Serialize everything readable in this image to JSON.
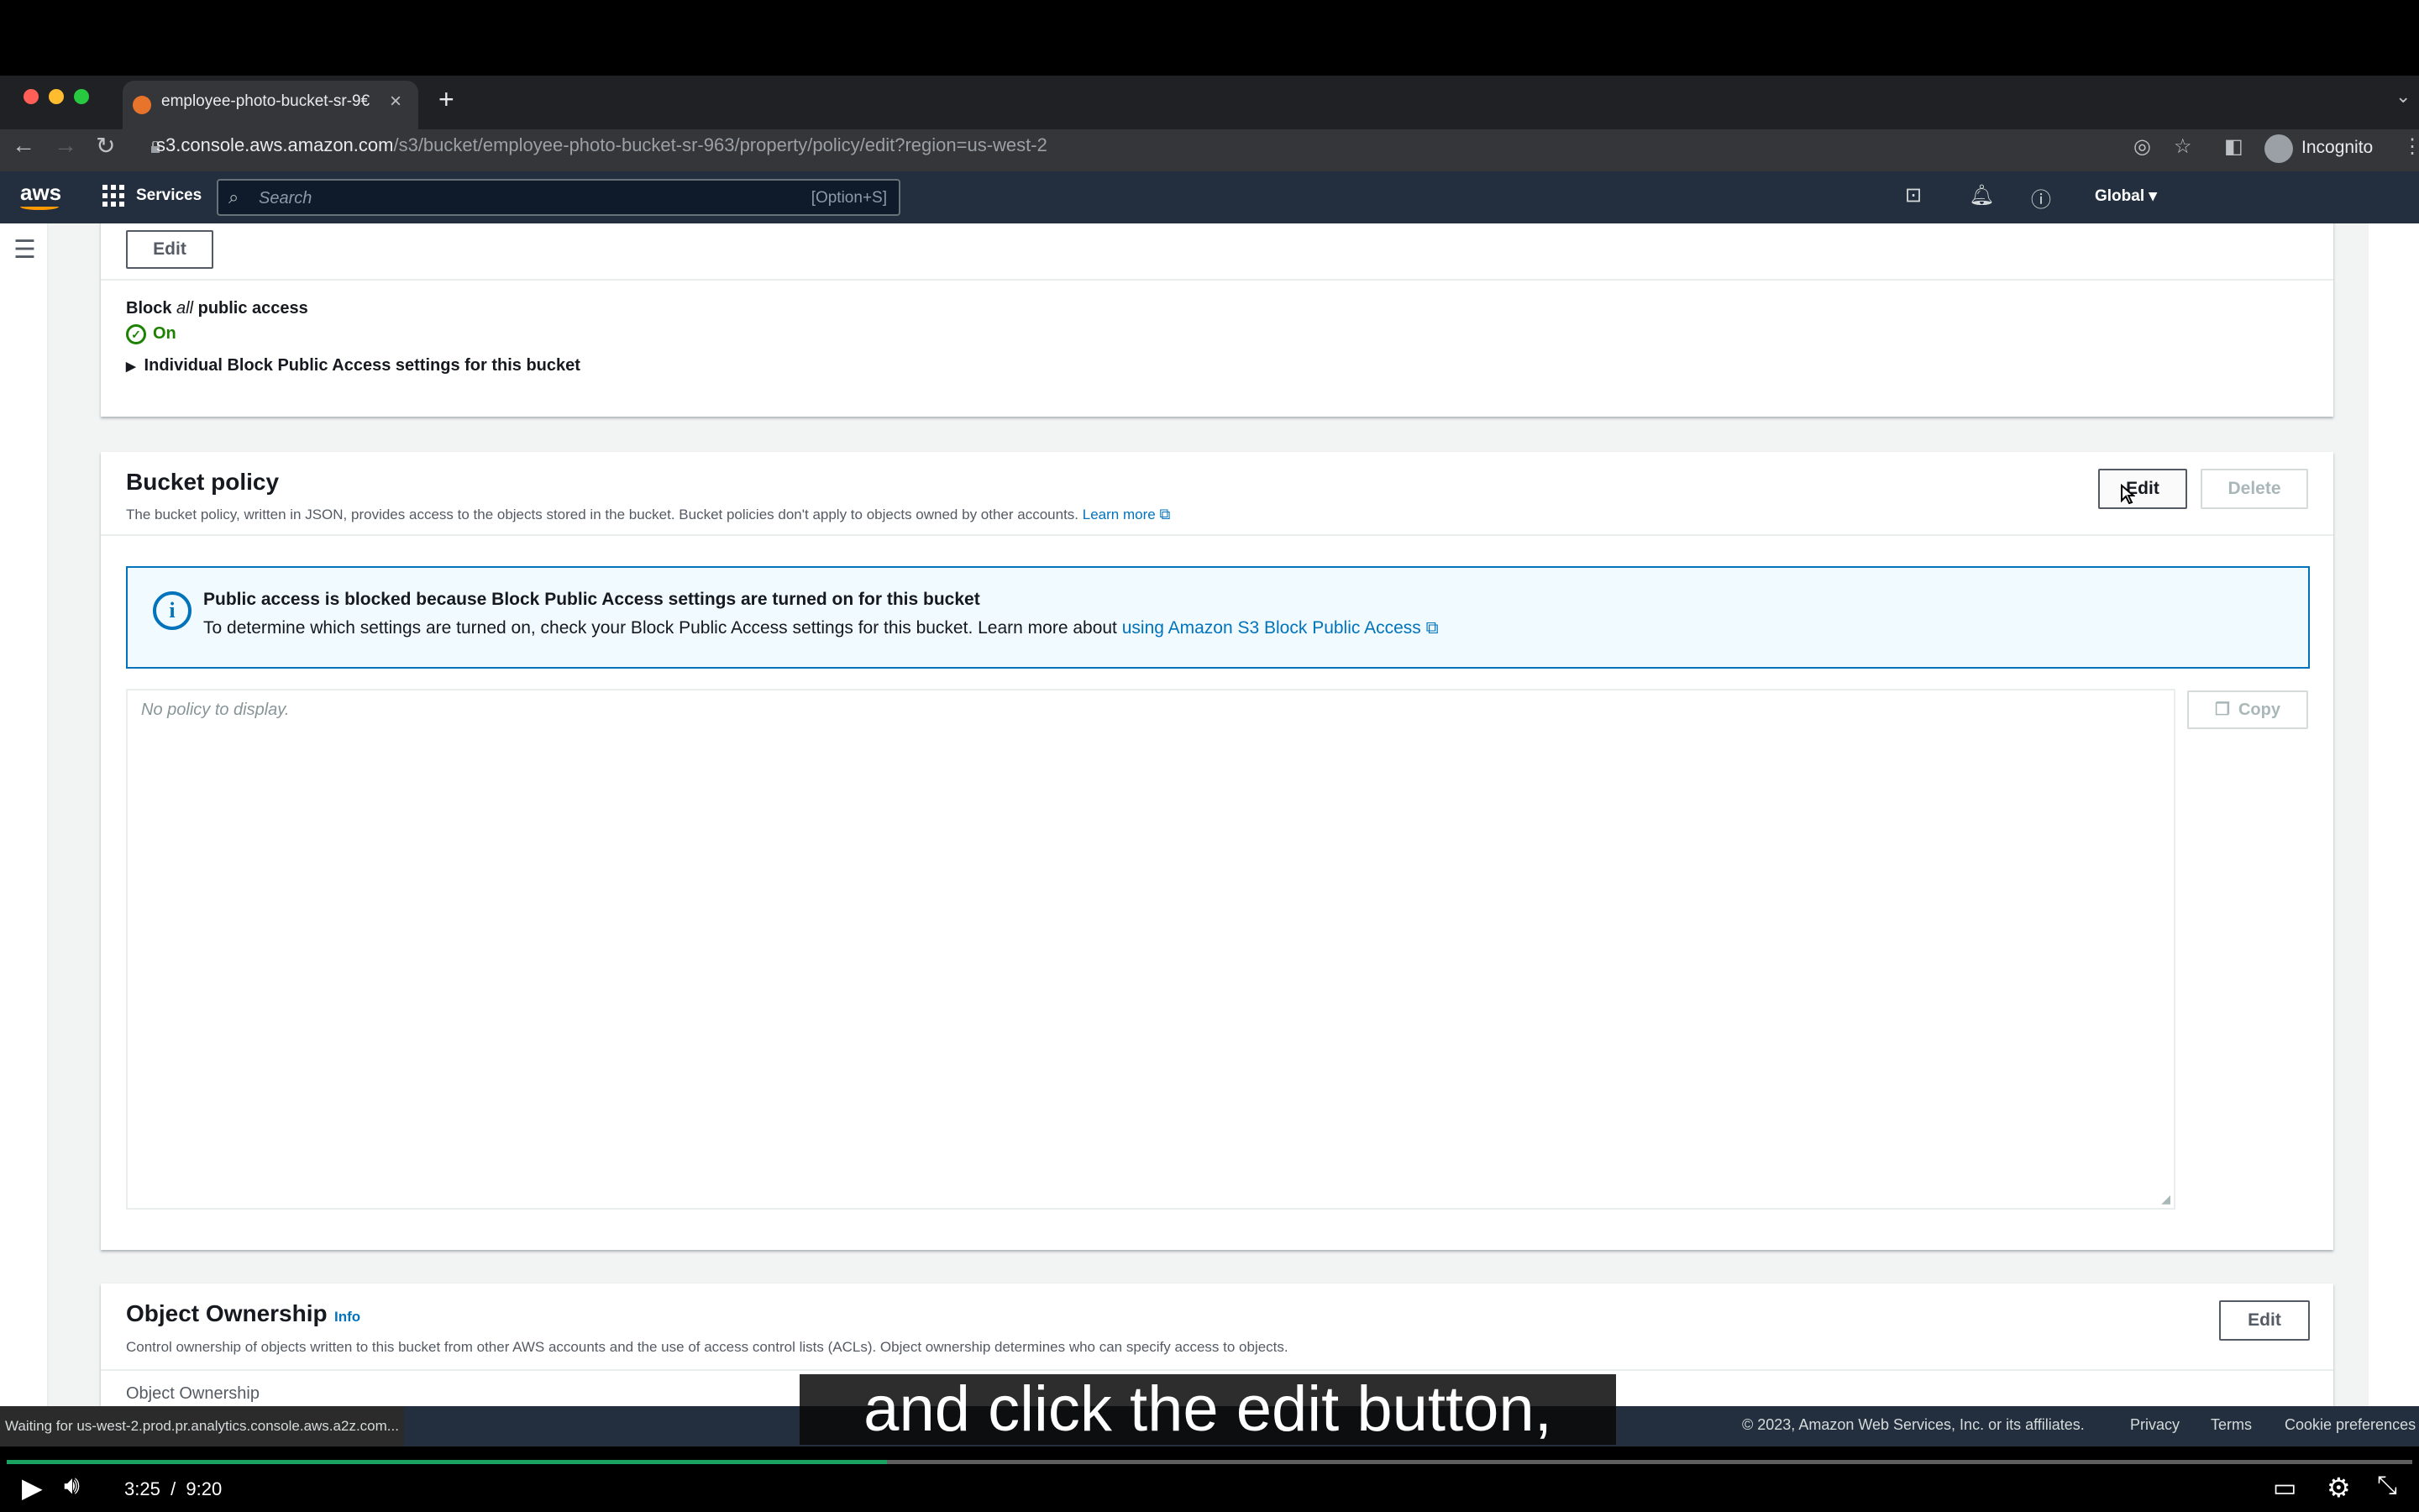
{
  "browser": {
    "tab_title": "employee-photo-bucket-sr-9€",
    "tab_close": "×",
    "new_tab": "+",
    "url_host": "s3.console.aws.amazon.com",
    "url_path": "/s3/bucket/employee-photo-bucket-sr-963/property/policy/edit?region=us-west-2",
    "profile_label": "Incognito"
  },
  "aws_nav": {
    "logo": "aws",
    "services_label": "Services",
    "search_placeholder": "Search",
    "search_shortcut": "[Option+S]",
    "region_label": "Global ▾"
  },
  "block_public_access": {
    "edit_label": "Edit",
    "title_prefix": "Block ",
    "title_italic": "all",
    "title_suffix": " public access",
    "status": "On",
    "expander_label": "Individual Block Public Access settings for this bucket"
  },
  "bucket_policy": {
    "title": "Bucket policy",
    "description": "The bucket policy, written in JSON, provides access to the objects stored in the bucket. Bucket policies don't apply to objects owned by other accounts.",
    "learn_more": "Learn more",
    "edit_label": "Edit",
    "delete_label": "Delete",
    "alert_title": "Public access is blocked because Block Public Access settings are turned on for this bucket",
    "alert_body": "To determine which settings are turned on, check your Block Public Access settings for this bucket. Learn more about",
    "alert_link": "using Amazon S3 Block Public Access",
    "policy_placeholder": "No policy to display.",
    "copy_label": "Copy"
  },
  "object_ownership": {
    "title": "Object Ownership",
    "info_label": "Info",
    "description": "Control ownership of objects written to this bucket from other AWS accounts and the use of access control lists (ACLs). Object ownership determines who can specify access to objects.",
    "edit_label": "Edit",
    "field_label": "Object Ownership"
  },
  "status_bar": {
    "loading": "Waiting for us-west-2.prod.pr.analytics.console.aws.a2z.com...",
    "copyright": "© 2023, Amazon Web Services, Inc. or its affiliates.",
    "privacy": "Privacy",
    "terms": "Terms",
    "cookie": "Cookie preferences"
  },
  "video": {
    "caption": "and click the edit button,",
    "current_time": "3:25",
    "separator": "/",
    "duration": "9:20",
    "progress_fraction": 0.366
  },
  "colors": {
    "aws_nav": "#232f3e",
    "accent_orange": "#ff9900",
    "link_blue": "#0073bb",
    "success_green": "#1d8102",
    "progress_green": "#1aa260"
  }
}
